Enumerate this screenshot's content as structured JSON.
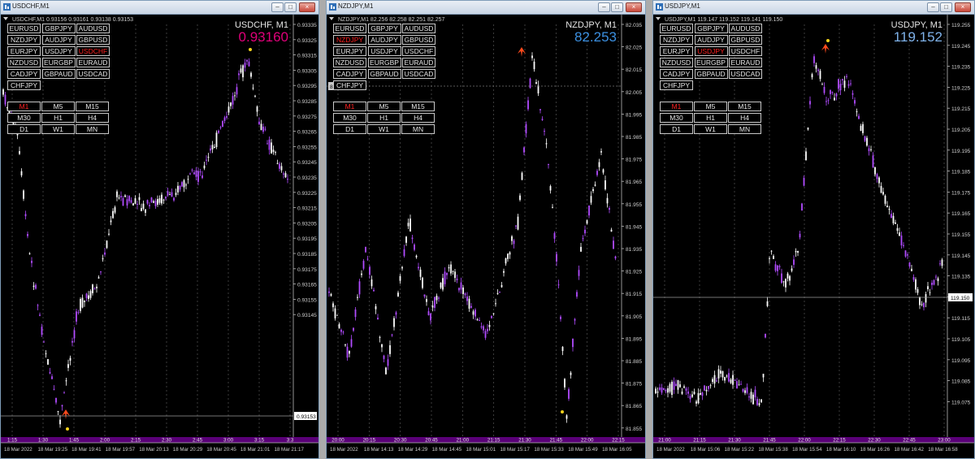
{
  "ui": {
    "minimize": "–",
    "maximize": "□",
    "close": "×"
  },
  "windows": [
    {
      "title": "USDCHF,M1",
      "info": "USDCHF,M1  0.93156 0.93161 0.93138 0.93153",
      "symbol_label": "USDCHF, M1",
      "big_price": "0.93160",
      "price_color": "#E0007A",
      "selected_symbol": "USDCHF",
      "symbols": [
        "EURUSD",
        "GBPJPY",
        "AUDUSD",
        "NZDJPY",
        "AUDJPY",
        "GBPUSD",
        "EURJPY",
        "USDJPY",
        "USDCHF",
        "NZDUSD",
        "EURGBP",
        "EURAUD",
        "CADJPY",
        "GBPAUD",
        "USDCAD",
        "CHFJPY"
      ],
      "timeframes": [
        "M1",
        "M5",
        "M15",
        "M30",
        "H1",
        "H4",
        "D1",
        "W1",
        "MN"
      ],
      "selected_timeframe": "M1",
      "price_ticks": [
        "0.93335",
        "0.93325",
        "0.93315",
        "0.93305",
        "0.93295",
        "0.93285",
        "0.93275",
        "0.93265",
        "0.93255",
        "0.93245",
        "0.93235",
        "0.93225",
        "0.93215",
        "0.93205",
        "0.93195",
        "0.93185",
        "0.93175",
        "0.93165",
        "0.93155",
        "0.93145"
      ],
      "current_price": "0.93153",
      "time_ticks": [
        "1:15",
        "1:30",
        "1:45",
        "2:00",
        "2:15",
        "2:30",
        "2:45",
        "3:00",
        "3:15",
        "3:3"
      ],
      "date_ticks": [
        "18 Mar 2022",
        "18 Mar 19:25",
        "18 Mar 19:41",
        "18 Mar 19:57",
        "18 Mar 20:13",
        "18 Mar 20:29",
        "18 Mar 20:45",
        "18 Mar 21:01",
        "18 Mar 21:17"
      ]
    },
    {
      "title": "NZDJPY,M1",
      "info": "NZDJPY,M1  82.256 82.258 82.251 82.257",
      "symbol_label": "NZDJPY, M1",
      "big_price": "82.253",
      "price_color": "#3B8FE0",
      "selected_symbol": "NZDJPY",
      "symbols": [
        "EURUSD",
        "GBPJPY",
        "AUDUSD",
        "NZDJPY",
        "AUDJPY",
        "GBPUSD",
        "EURJPY",
        "USDJPY",
        "USDCHF",
        "NZDUSD",
        "EURGBP",
        "EURAUD",
        "CADJPY",
        "GBPAUD",
        "USDCAD",
        "CHFJPY"
      ],
      "timeframes": [
        "M1",
        "M5",
        "M15",
        "M30",
        "H1",
        "H4",
        "D1",
        "W1",
        "MN"
      ],
      "selected_timeframe": "M1",
      "price_ticks": [
        "82.035",
        "82.025",
        "82.015",
        "82.005",
        "81.995",
        "81.985",
        "81.975",
        "81.965",
        "81.955",
        "81.945",
        "81.935",
        "81.925",
        "81.915",
        "81.905",
        "81.895",
        "81.885",
        "81.875",
        "81.865",
        "81.855"
      ],
      "current_price": "",
      "crosshair_label": "82.0",
      "time_ticks": [
        "20:00",
        "20:15",
        "20:30",
        "20:45",
        "21:00",
        "21:15",
        "21:30",
        "21:45",
        "22:00",
        "22:15"
      ],
      "date_ticks": [
        "18 Mar 2022",
        "18 Mar 14:13",
        "18 Mar 14:29",
        "18 Mar 14:45",
        "18 Mar 15:01",
        "18 Mar 15:17",
        "18 Mar 15:33",
        "18 Mar 15:49",
        "18 Mar 16:05"
      ]
    },
    {
      "title": "USDJPY,M1",
      "info": "USDJPY,M1  119.147 119.152 119.141 119.150",
      "symbol_label": "USDJPY, M1",
      "big_price": "119.152",
      "price_color": "#7FB2EA",
      "selected_symbol": "USDJPY",
      "symbols": [
        "EURUSD",
        "GBPJPY",
        "AUDUSD",
        "NZDJPY",
        "AUDJPY",
        "GBPUSD",
        "EURJPY",
        "USDJPY",
        "USDCHF",
        "NZDUSD",
        "EURGBP",
        "EURAUD",
        "CADJPY",
        "GBPAUD",
        "USDCAD",
        "CHFJPY"
      ],
      "timeframes": [
        "M1",
        "M5",
        "M15",
        "M30",
        "H1",
        "H4",
        "D1",
        "W1",
        "MN"
      ],
      "selected_timeframe": "M1",
      "price_ticks": [
        "119.255",
        "119.245",
        "119.235",
        "119.225",
        "119.215",
        "119.205",
        "119.195",
        "119.185",
        "119.175",
        "119.165",
        "119.155",
        "119.145",
        "119.135",
        "119.125",
        "119.115",
        "119.105",
        "119.095",
        "119.085",
        "119.075"
      ],
      "current_price": "119.150",
      "time_ticks": [
        "21:00",
        "21:15",
        "21:30",
        "21:45",
        "22:00",
        "22:15",
        "22:30",
        "22:45",
        "23:00"
      ],
      "date_ticks": [
        "18 Mar 2022",
        "18 Mar 15:06",
        "18 Mar 15:22",
        "18 Mar 15:38",
        "18 Mar 15:54",
        "18 Mar 16:10",
        "18 Mar 16:26",
        "18 Mar 16:42",
        "18 Mar 16:58"
      ]
    }
  ]
}
